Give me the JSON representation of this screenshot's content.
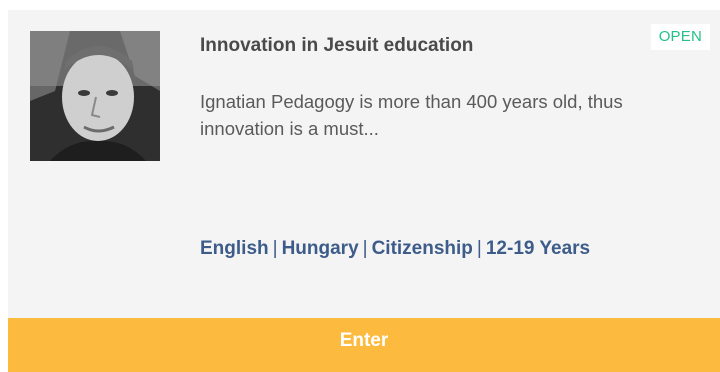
{
  "course": {
    "status_badge": "OPEN",
    "title": "Innovation in Jesuit education",
    "description": "Ignatian Pedagogy is more than 400 years old, thus innovation is a must...",
    "tags": [
      "English",
      "Hungary",
      "Citizenship",
      "12-19 Years"
    ],
    "enter_label": "Enter",
    "photo": "portrait-photo"
  },
  "colors": {
    "card_background": "#f4f4f5",
    "badge_text": "#27c08a",
    "title_text": "#4a4a4a",
    "tag_text": "#3d5c8a",
    "enter_button": "#fcbb3f"
  }
}
